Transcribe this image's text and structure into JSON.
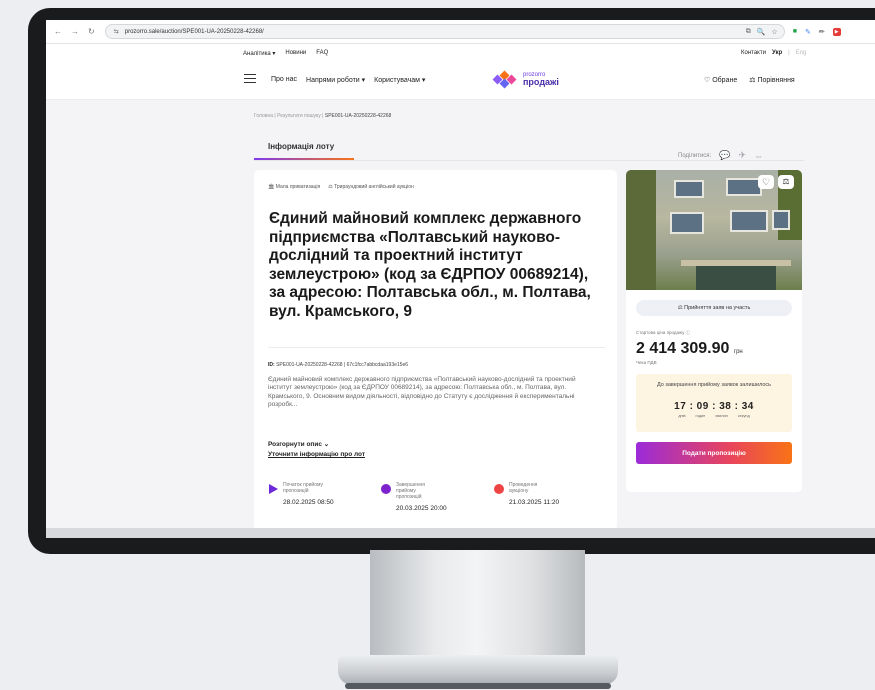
{
  "browser": {
    "url": "prozorro.sale/auction/SPE001-UA-20250228-42268/",
    "nav_back": "←",
    "nav_forward": "→",
    "reload": "↻",
    "tune": "⇆",
    "actions": [
      "⧉",
      "🔍",
      "☆"
    ]
  },
  "topbar": {
    "links": [
      "Аналітика ▾",
      "Новини",
      "FAQ"
    ],
    "contacts": "Контакти",
    "lang_ua": "Укр",
    "lang_sep": "|",
    "lang_en": "Eng"
  },
  "header": {
    "menu": [
      "Про нас",
      "Напрями роботи ▾",
      "Користувачам ▾"
    ],
    "logo_top": "prozorro",
    "logo_bottom": "продажі",
    "favorites": "♡ Обране",
    "compare": "⚖ Порівняння",
    "logo_colors": [
      "#8b5cf6",
      "#f97316",
      "#6366f1",
      "#ec4899"
    ]
  },
  "breadcrumbs": {
    "home": "Головна",
    "sep": "|",
    "results": "Результати пошуку",
    "current": "SPE001-UA-20250228-42268"
  },
  "tabs": {
    "info": "Інформація лоту"
  },
  "share": {
    "label": "Поділитися:",
    "icons": [
      "💬",
      "✈",
      "⇔"
    ]
  },
  "lot": {
    "tag1": "🏛 Мала приватизація",
    "tag2": "⚖ Трираундовий англійський аукціон",
    "title": "Єдиний майновий комплекс державного підприємства «Полтавський науково-дослідний та проектний інститут землеустрою» (код за ЄДРПОУ 00689214), за адресою: Полтавська обл., м. Полтава, вул. Крамського, 9",
    "id_label": "ID:",
    "id_value": "SPE001-UA-20250228-42268 | 67c1fcc7abbcdaa193e15e6",
    "description": "Єдиний майновий комплекс державного підприємства «Полтавський науково-дослідний та проектний інститут землеустрою» (код за ЄДРПОУ 00689214), за адресою: Полтавська обл., м. Полтава, вул. Крамського, 9. Основним видом діяльності, відповідно до Статуту є дослідження й експериментальні розробк...",
    "expand": "Розгорнути опис ⌄",
    "clarify": "Уточнити інформацію про лот",
    "timeline": [
      {
        "label": "Початок прийому пропозицій",
        "date": "28.02.2025  08:50",
        "color": "#6d28d9",
        "shape": "triangle"
      },
      {
        "label": "Завершення прийому пропозицій",
        "date": "20.03.2025  20:00",
        "color": "#7e22ce",
        "shape": "circle"
      },
      {
        "label": "Проведення аукціону",
        "date": "21.03.2025  11:20",
        "color": "#ef4444",
        "shape": "circle"
      }
    ]
  },
  "side": {
    "fav_icon": "♡",
    "compare_icon": "⚖",
    "accept": "⚖ Прийняття заяв на участь",
    "start_price_label": "Стартова ціна продажу ⓘ",
    "price": "2 414 309.90",
    "currency": "грн",
    "vat": "Чека ПДВ",
    "timer_title": "До завершення прийому заявок залишилось",
    "timer_value": "17 : 09 : 38 : 34",
    "timer_units": [
      "днів",
      "годин",
      "хвилин",
      "секунд"
    ],
    "bid_button": "Подати пропозицію"
  }
}
